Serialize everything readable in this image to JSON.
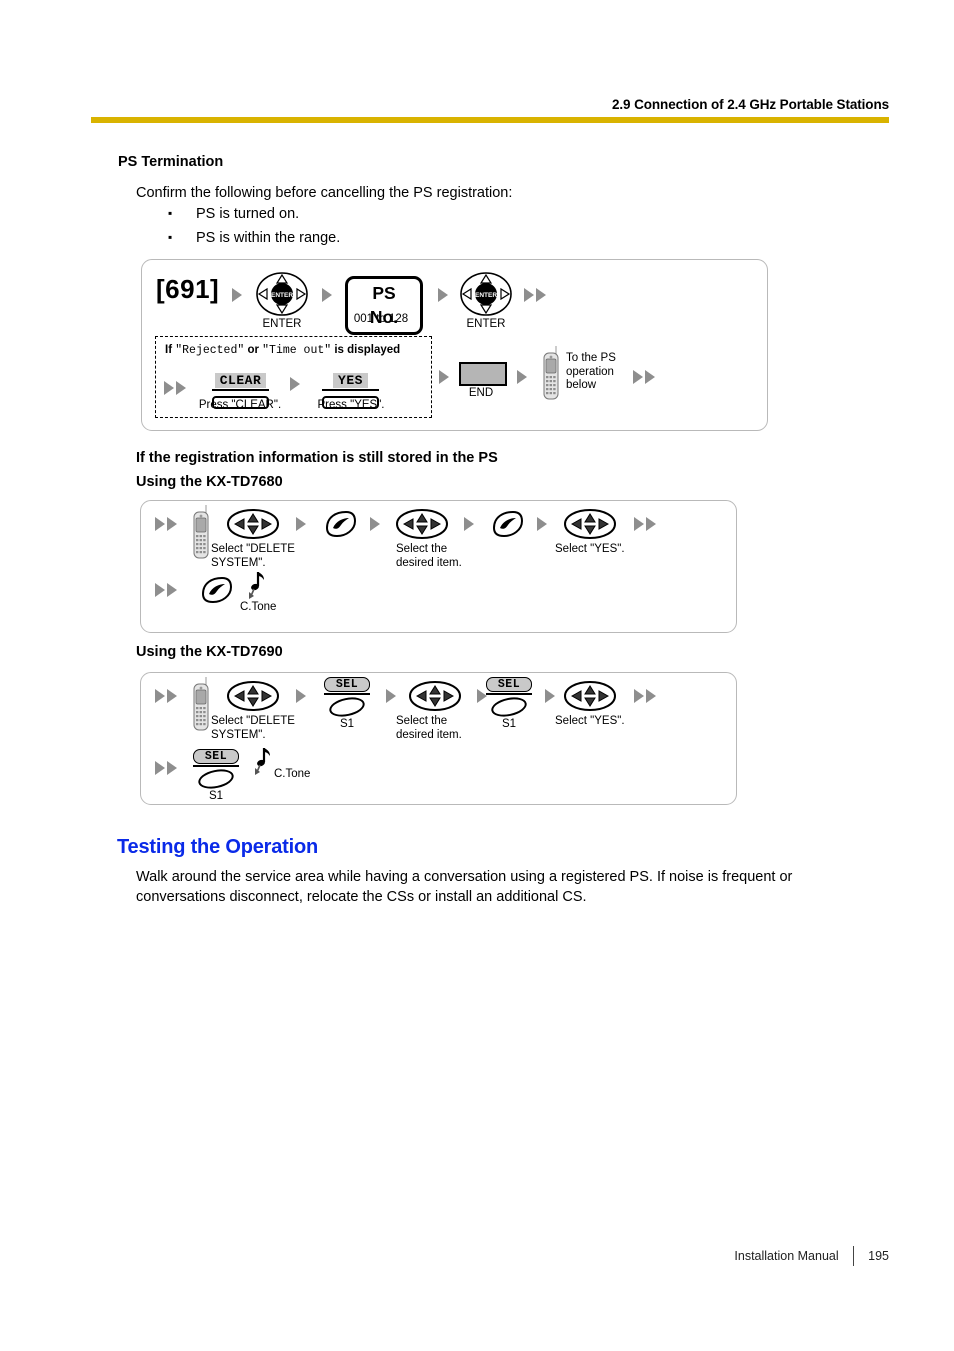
{
  "header": {
    "section_title": "2.9 Connection of 2.4 GHz Portable Stations",
    "rule_color": "#d9b300"
  },
  "ps_termination": {
    "heading": "PS Termination",
    "intro": "Confirm the following before cancelling the PS registration:",
    "bullets": [
      "PS is turned on.",
      "PS is within the range."
    ]
  },
  "flow_main": {
    "code": "[691]",
    "enter_label_1": "ENTER",
    "ps_no_label": "PS No.",
    "ps_no_range": "001 to 128",
    "enter_label_2": "ENTER",
    "condition_note_pre": "If ",
    "condition_note_q1": "\"Rejected\"",
    "condition_note_mid": " or ",
    "condition_note_q2": "\"Time out\"",
    "condition_note_post": " is displayed",
    "softkey_clear": "CLEAR",
    "softkey_clear_caption": "Press \"CLEAR\".",
    "softkey_yes": "YES",
    "softkey_yes_caption": "Press \"YES\".",
    "end_label": "END",
    "to_ps_note": "To the PS\noperation\nbelow"
  },
  "still_stored": {
    "heading": "If the registration information is still stored in the PS",
    "sub_heading_7680": "Using the KX-TD7680",
    "sub_heading_7690": "Using the KX-TD7690"
  },
  "flow_7680": {
    "step1_caption": "Select \"DELETE\nSYSTEM\".",
    "step2_caption": "Select the\ndesired item.",
    "step3_caption": "Select \"YES\".",
    "tone_caption": "C.Tone"
  },
  "flow_7690": {
    "step1_caption": "Select \"DELETE\nSYSTEM\".",
    "sel_label": "SEL",
    "sel_sub": "S1",
    "step2_caption": "Select the\ndesired item.",
    "step3_caption": "Select \"YES\".",
    "tone_caption": "C.Tone"
  },
  "testing": {
    "title": "Testing the Operation",
    "title_color": "#0a2ae8",
    "paragraph_line1": "Walk around the service area while having a conversation using a registered PS. If noise is frequent or",
    "paragraph_line2": "conversations disconnect, relocate the CSs or install an additional CS."
  },
  "footer": {
    "manual": "Installation Manual",
    "page": "195"
  }
}
